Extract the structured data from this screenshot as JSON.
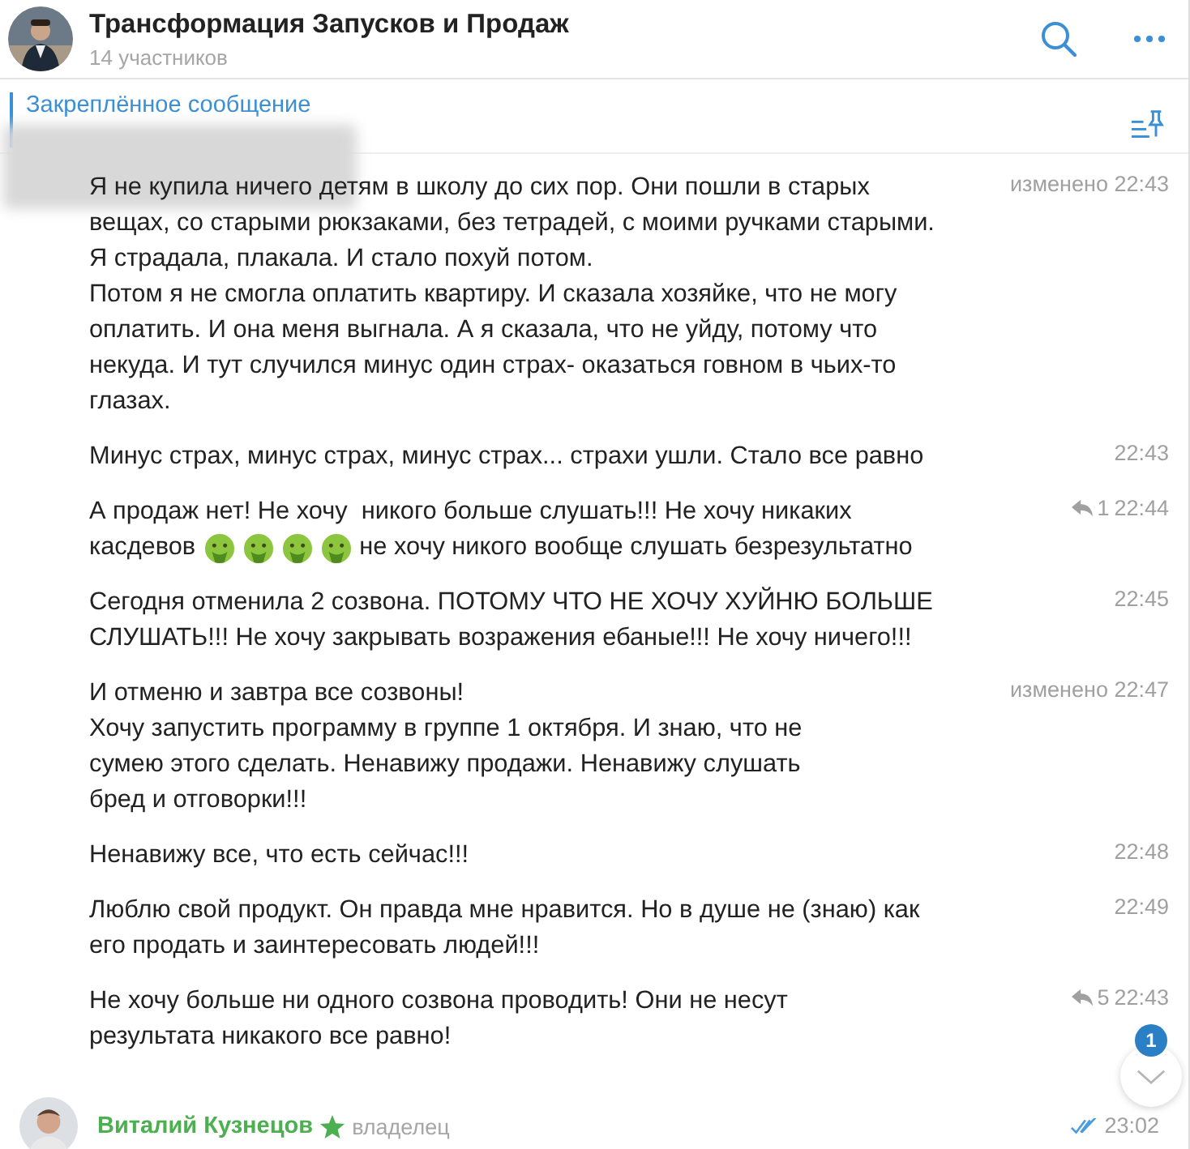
{
  "header": {
    "title": "Трансформация Запусков и Продаж",
    "subtitle": "14 участников"
  },
  "pinned": {
    "label": "Закреплённое сообщение"
  },
  "messages": [
    {
      "lines": [
        "Я не купила ничего детям в школу до сих пор. Они пошли в старых",
        "вещах, со старыми рюкзаками, без тетрадей, с моими ручками старыми.",
        "Я страдала, плакала. И стало похуй потом.",
        "Потом я не смогла оплатить квартиру. И сказала хозяйке, что не могу",
        "оплатить. И она меня выгнала. А я сказала, что не уйду, потому что",
        "некуда. И тут случился минус один страх- оказаться говном в чьих-то",
        "глазах."
      ],
      "time": "изменено 22:43"
    },
    {
      "lines": [
        "Минус страх, минус страх, минус страх... страхи ушли. Стало все равно"
      ],
      "time": "22:43"
    },
    {
      "lines": [
        "А продаж нет! Не хочу  никого больше слушать!!! Не хочу никаких",
        {
          "parts": [
            {
              "kind": "text",
              "text": "касдевов"
            },
            {
              "kind": "emoji"
            },
            {
              "kind": "emoji"
            },
            {
              "kind": "emoji"
            },
            {
              "kind": "emoji"
            },
            {
              "kind": "text",
              "text": "не хочу никого вообще слушать безрезультатно"
            }
          ]
        }
      ],
      "replies": "1",
      "time": "22:44"
    },
    {
      "lines": [
        "Сегодня отменила 2 созвона. ПОТОМУ ЧТО НЕ ХОЧУ ХУЙНЮ БОЛЬШЕ",
        "СЛУШАТЬ!!! Не хочу закрывать возражения ебаные!!! Не хочу ничего!!!"
      ],
      "time": "22:45"
    },
    {
      "lines": [
        "И отменю и завтра все созвоны!",
        "Хочу запустить программу в группе 1 октября. И знаю, что не",
        "сумею этого сделать. Ненавижу продажи. Ненавижу слушать",
        "бред и отговорки!!!"
      ],
      "time": "изменено 22:47"
    },
    {
      "lines": [
        "Ненавижу все, что есть сейчас!!!"
      ],
      "time": "22:48"
    },
    {
      "lines": [
        "Люблю свой продукт. Он правда мне нравится. Но в душе не (знаю) как",
        "его продать и заинтересовать людей!!!"
      ],
      "time": "22:49"
    },
    {
      "lines": [
        "Не хочу больше ни одного созвона проводить! Они не несут",
        "результата никакого все равно!"
      ],
      "replies": "5",
      "time": "22:43"
    }
  ],
  "scroll_button": {
    "badge": "1"
  },
  "next_message": {
    "author": "Виталий Кузнецов",
    "role": "владелец",
    "read": true,
    "time": "23:02"
  }
}
